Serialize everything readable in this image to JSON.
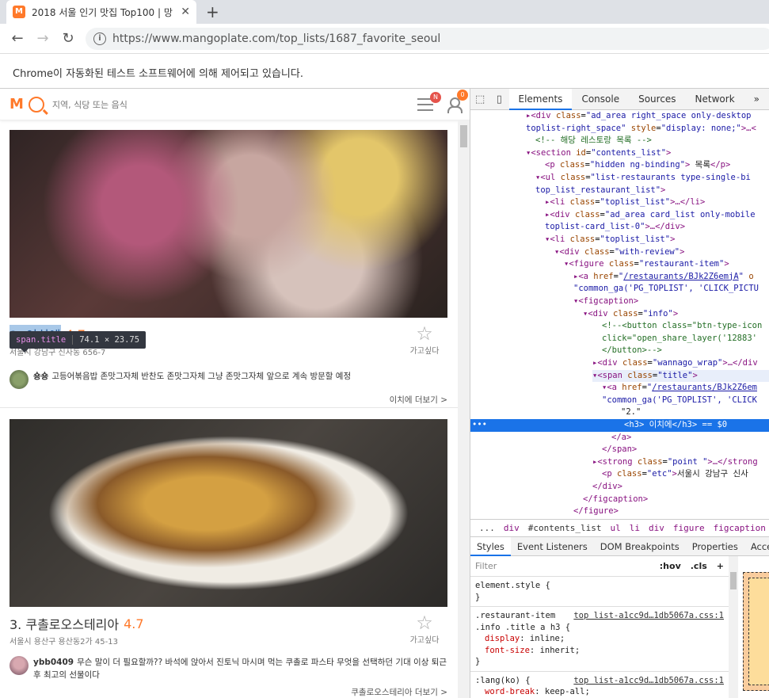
{
  "browser": {
    "tab_title": "2018 서울 인기 맛집 Top100 | 망",
    "tab_favicon": "M",
    "new_tab": "+",
    "url": "https://www.mangoplate.com/top_lists/1687_favorite_seoul",
    "automation_notice": "Chrome이 자동화된 테스트 소프트웨어에 의해 제어되고 있습니다."
  },
  "site": {
    "logo": "M",
    "search_placeholder": "지역, 식당 또는 음식",
    "notif_badge": "N",
    "user_badge": "0"
  },
  "tooltip": {
    "selector": "span.title",
    "size": "74.1 × 23.75"
  },
  "restaurants": [
    {
      "name": "2. 이치에",
      "score": "4.7",
      "address": "서울시 강남구 신사동 656-7",
      "want_label": "가고싶다",
      "reviewer": "숑숑",
      "review": "고등어볶음밥 존맛그자체 반찬도 존맛그자체 그냥 존맛그자체 앞으로 계속 방문할 예정",
      "more": "이치에 더보기 >"
    },
    {
      "name": "3. 쿠촐로오스테리아",
      "score": "4.7",
      "address": "서울시 용산구 용산동2가 45-13",
      "want_label": "가고싶다",
      "reviewer": "ybb0409",
      "review": "무슨 말이 더 필요할까?? 바석에 앉아서 진토닉 마시며 먹는 쿠촐로 파스타 무엇을 선택하던 기대 이상 퇴근 후 최고의 선물이다",
      "more": "쿠촐로오스테리아 더보기 >"
    }
  ],
  "devtools": {
    "tabs": [
      "Elements",
      "Console",
      "Sources",
      "Network"
    ],
    "overflow": "»",
    "breadcrumbs": [
      "...",
      "div",
      "#contents_list",
      "ul",
      "li",
      "div",
      "figure",
      "figcaption",
      "div",
      "sp"
    ],
    "pane_tabs": [
      "Styles",
      "Event Listeners",
      "DOM Breakpoints",
      "Properties",
      "Access"
    ],
    "filter_placeholder": "Filter",
    "hov": ":hov",
    "cls": ".cls",
    "add": "+",
    "styles": {
      "element_style": "element.style {",
      "close": "}",
      "rule1_sel1": ".restaurant-item",
      "rule1_src": "top list-a1cc9d…1db5067a.css:1",
      "rule1_sel2": ".info .title a h3 {",
      "rule1_p1": "display",
      "rule1_v1": "inline;",
      "rule1_p2": "font-size",
      "rule1_v2": "inherit;",
      "rule2_sel": ":lang(ko) {",
      "rule2_src": "top list-a1cc9d…1db5067a.css:1",
      "rule2_p1": "word-break",
      "rule2_v1": "keep-all;"
    }
  }
}
